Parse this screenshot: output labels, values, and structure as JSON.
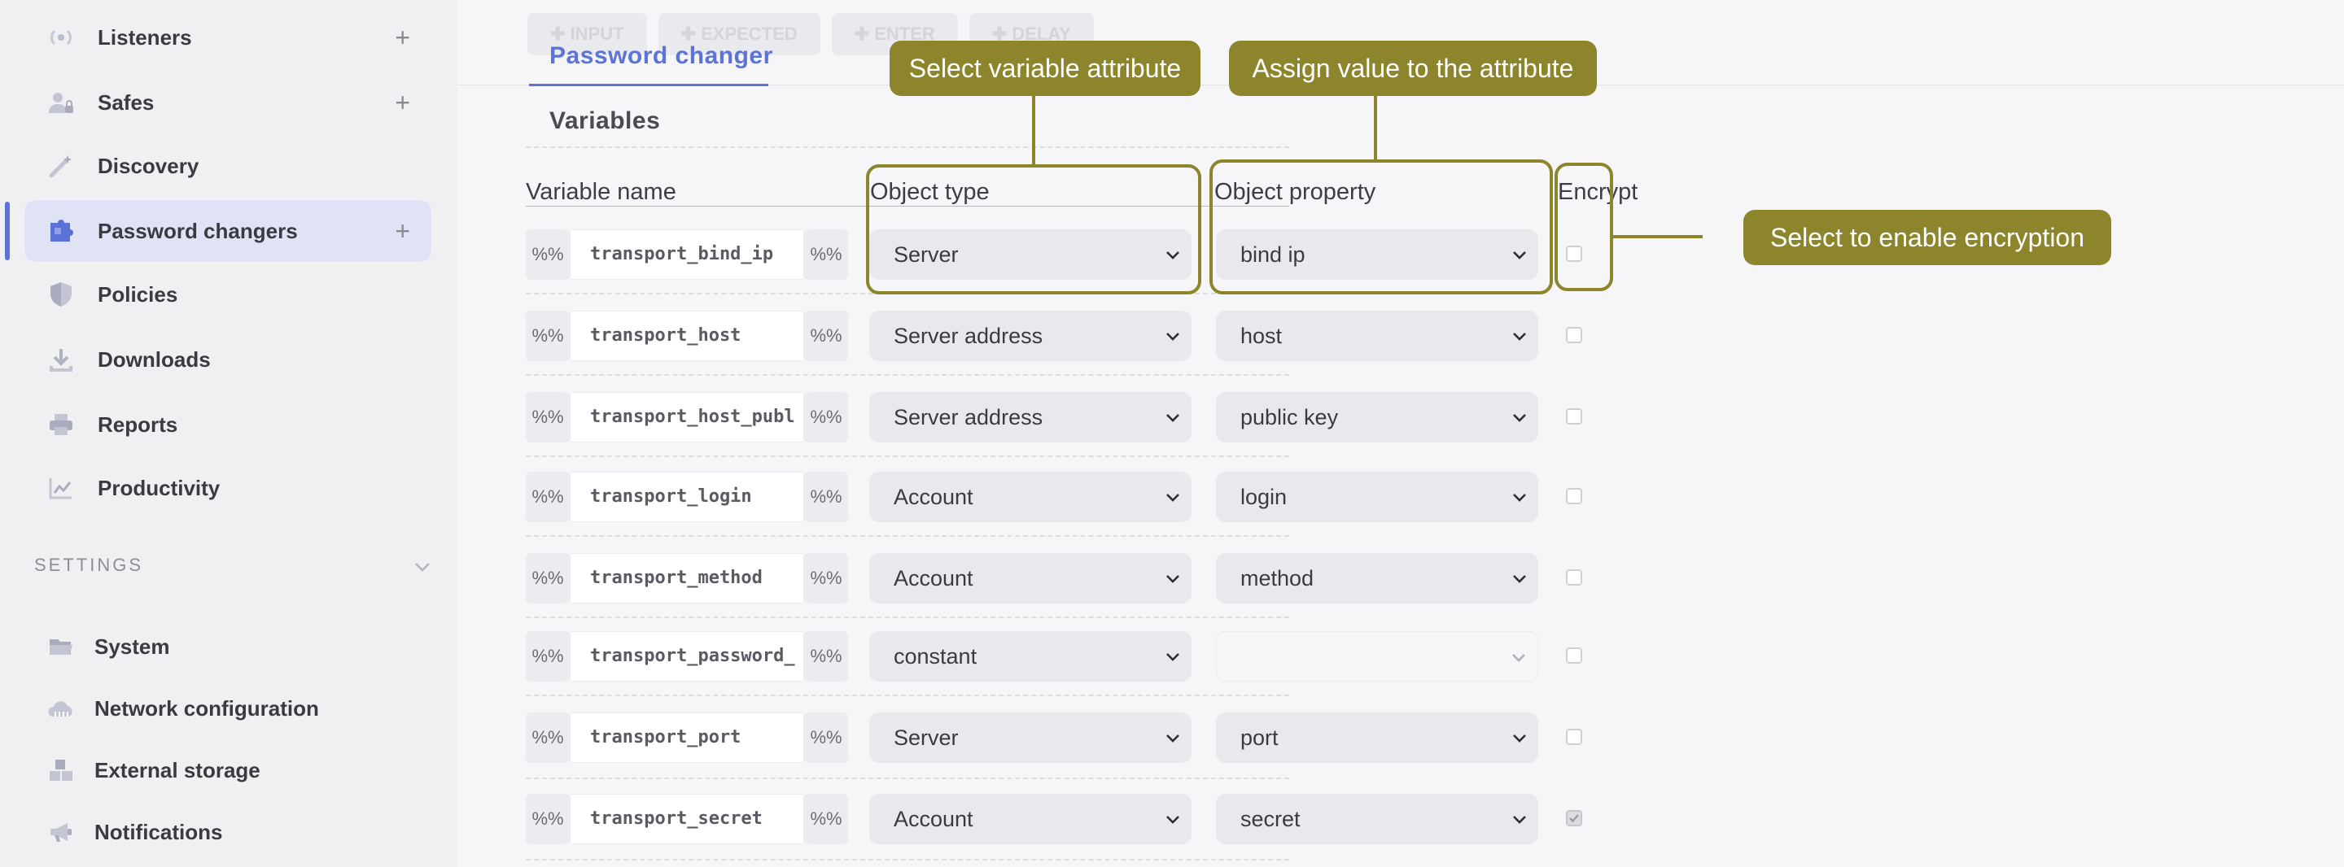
{
  "sidebar": {
    "items": [
      {
        "label": "Listeners",
        "plus": "+"
      },
      {
        "label": "Safes",
        "plus": "+"
      },
      {
        "label": "Discovery"
      },
      {
        "label": "Password changers",
        "plus": "+"
      },
      {
        "label": "Policies"
      },
      {
        "label": "Downloads"
      },
      {
        "label": "Reports"
      },
      {
        "label": "Productivity"
      }
    ],
    "settings_header": "SETTINGS",
    "settings_items": [
      {
        "label": "System"
      },
      {
        "label": "Network configuration"
      },
      {
        "label": "External storage"
      },
      {
        "label": "Notifications"
      }
    ],
    "accent": "#5a72d6",
    "active_bg": "#dfe3f5"
  },
  "tabs": {
    "ghost": [
      "✚ INPUT",
      "✚ EXPECTED",
      "✚ ENTER",
      "✚ DELAY"
    ],
    "active": "Password changer"
  },
  "section": {
    "title": "Variables"
  },
  "table": {
    "headers": {
      "name": "Variable name",
      "type": "Object type",
      "property": "Object property",
      "encrypt": "Encrypt"
    },
    "delimiter": "%%",
    "rows": [
      {
        "name": "transport_bind_ip",
        "type": "Server",
        "property": "bind ip",
        "encrypt": false
      },
      {
        "name": "transport_host",
        "type": "Server address",
        "property": "host",
        "encrypt": false
      },
      {
        "name": "transport_host_publ",
        "type": "Server address",
        "property": "public key",
        "encrypt": false
      },
      {
        "name": "transport_login",
        "type": "Account",
        "property": "login",
        "encrypt": false
      },
      {
        "name": "transport_method",
        "type": "Account",
        "property": "method",
        "encrypt": false
      },
      {
        "name": "transport_password_",
        "type": "constant",
        "property": "",
        "encrypt": false
      },
      {
        "name": "transport_port",
        "type": "Server",
        "property": "port",
        "encrypt": false
      },
      {
        "name": "transport_secret",
        "type": "Account",
        "property": "secret",
        "encrypt": true
      }
    ]
  },
  "callouts": {
    "type": "Select variable attribute",
    "property": "Assign value to the attribute",
    "encrypt": "Select to enable encryption",
    "color": "#8d852b"
  }
}
